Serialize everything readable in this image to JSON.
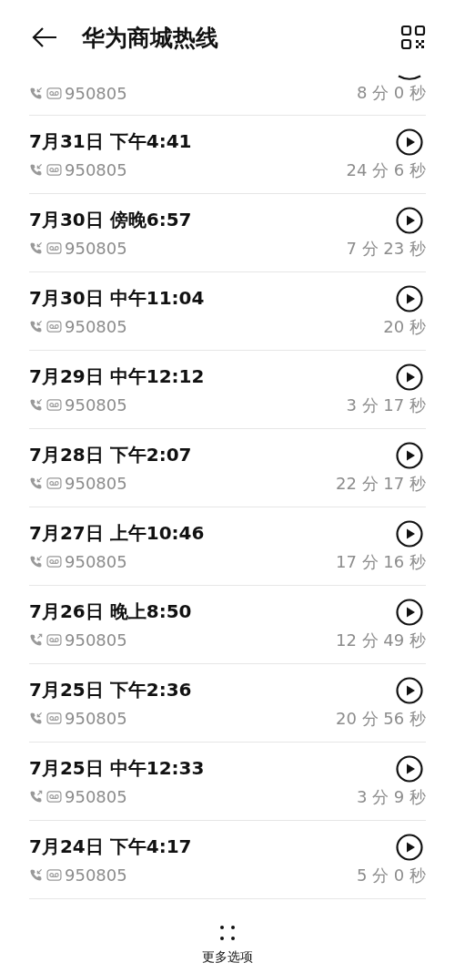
{
  "header": {
    "title": "华为商城热线"
  },
  "calls": [
    {
      "partial": true,
      "kind": "incoming",
      "number": "950805",
      "duration": "8 分 0 秒"
    },
    {
      "date": "7月31日 下午4:41",
      "kind": "incoming",
      "number": "950805",
      "duration": "24 分 6 秒"
    },
    {
      "date": "7月30日 傍晚6:57",
      "kind": "incoming",
      "number": "950805",
      "duration": "7 分 23 秒"
    },
    {
      "date": "7月30日 中午11:04",
      "kind": "incoming",
      "number": "950805",
      "duration": "20 秒"
    },
    {
      "date": "7月29日 中午12:12",
      "kind": "incoming",
      "number": "950805",
      "duration": "3 分 17 秒"
    },
    {
      "date": "7月28日 下午2:07",
      "kind": "incoming",
      "number": "950805",
      "duration": "22 分 17 秒"
    },
    {
      "date": "7月27日 上午10:46",
      "kind": "incoming",
      "number": "950805",
      "duration": "17 分 16 秒"
    },
    {
      "date": "7月26日 晚上8:50",
      "kind": "outgoing",
      "number": "950805",
      "duration": "12 分 49 秒"
    },
    {
      "date": "7月25日 下午2:36",
      "kind": "incoming",
      "number": "950805",
      "duration": "20 分 56 秒"
    },
    {
      "date": "7月25日 中午12:33",
      "kind": "outgoing",
      "number": "950805",
      "duration": "3 分 9 秒"
    },
    {
      "date": "7月24日 下午4:17",
      "kind": "incoming",
      "number": "950805",
      "duration": "5 分 0 秒"
    }
  ],
  "footer": {
    "label": "更多选项"
  }
}
